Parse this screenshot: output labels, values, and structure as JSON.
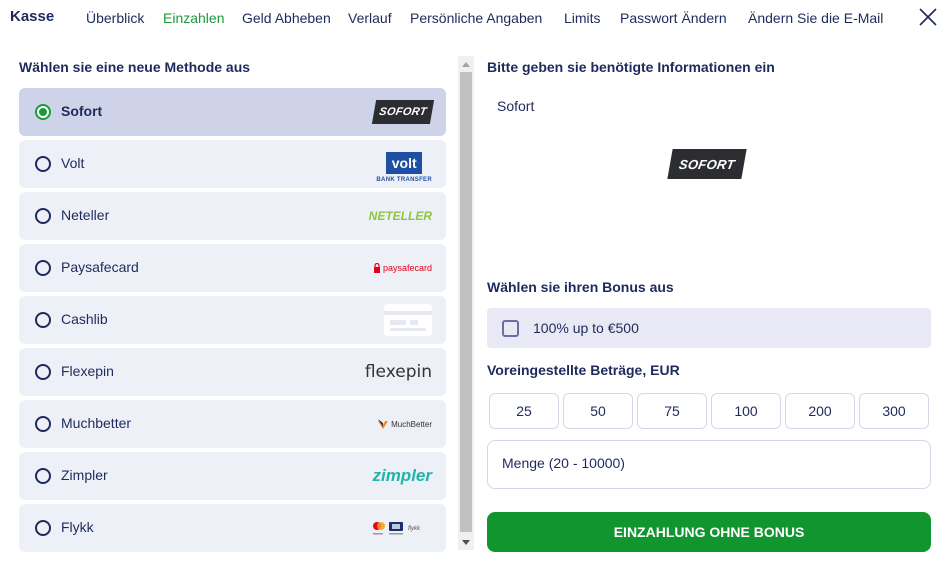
{
  "nav": {
    "title": "Kasse",
    "items": [
      {
        "label": "Überblick",
        "active": false
      },
      {
        "label": "Einzahlen",
        "active": true
      },
      {
        "label": "Geld Abheben",
        "active": false
      },
      {
        "label": "Verlauf",
        "active": false
      },
      {
        "label": "Persönliche Angaben",
        "active": false
      },
      {
        "label": "Limits",
        "active": false
      },
      {
        "label": "Passwort Ändern",
        "active": false
      },
      {
        "label": "Ändern Sie die E-Mail",
        "active": false
      }
    ],
    "close_icon": "close-icon"
  },
  "left": {
    "heading": "Wählen sie eine neue Methode aus",
    "methods": [
      {
        "label": "Sofort",
        "selected": true,
        "logo": "SOFORT"
      },
      {
        "label": "Volt",
        "selected": false,
        "logo": "volt",
        "logo_sub": "BANK TRANSFER"
      },
      {
        "label": "Neteller",
        "selected": false,
        "logo": "NETELLER"
      },
      {
        "label": "Paysafecard",
        "selected": false,
        "logo": "paysafecard"
      },
      {
        "label": "Cashlib",
        "selected": false,
        "logo": "card-icon"
      },
      {
        "label": "Flexepin",
        "selected": false,
        "logo": "flexepin"
      },
      {
        "label": "Muchbetter",
        "selected": false,
        "logo": "MuchBetter"
      },
      {
        "label": "Zimpler",
        "selected": false,
        "logo": "zimpler"
      },
      {
        "label": "Flykk",
        "selected": false,
        "logo": "flykk-cards"
      }
    ]
  },
  "right": {
    "heading": "Bitte geben sie benötigte Informationen ein",
    "method_name": "Sofort",
    "big_logo": "SOFORT",
    "bonus_heading": "Wählen sie ihren Bonus aus",
    "bonus_label": "100% up to €500",
    "preset_heading": "Voreingestellte Beträge, EUR",
    "presets": [
      "25",
      "50",
      "75",
      "100",
      "200",
      "300"
    ],
    "amount_placeholder": "Menge (20 - 10000)",
    "deposit_button": "EINZAHLUNG OHNE BONUS"
  },
  "colors": {
    "text": "#1f2a5c",
    "accent_green": "#11962f",
    "selected_row": "#cfd3e9",
    "row": "#eef0f8"
  }
}
